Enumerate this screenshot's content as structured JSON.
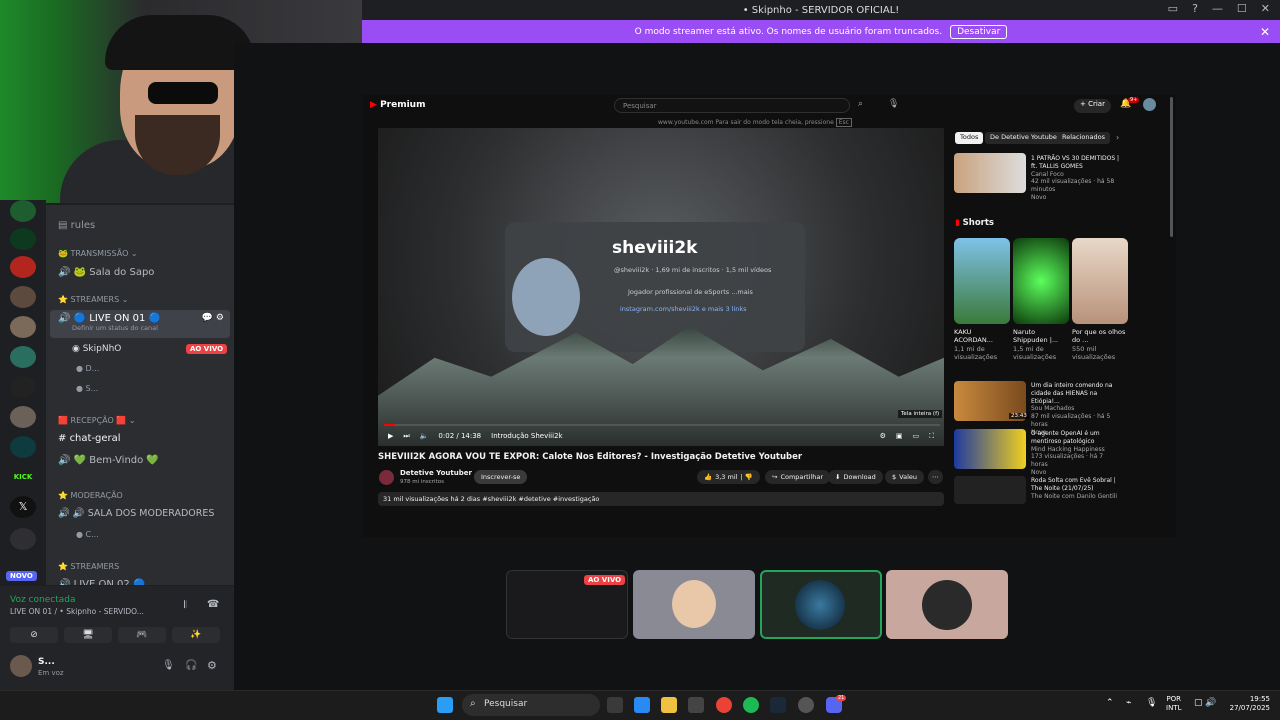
{
  "window": {
    "title": "• Skipnho - SERVIDOR OFICIAL!"
  },
  "banner": {
    "text": "O modo streamer está ativo. Os nomes de usuário foram truncados.",
    "button": "Desativar"
  },
  "channels": {
    "rules": "rules",
    "cat_transmissao": "TRANSMISSÃO",
    "sala_sapo": "Sala do Sapo",
    "cat_streamers": "STREAMERS",
    "live_on_01": "LIVE ON 01",
    "status_hint": "Definir um status do canal",
    "user1": "SkipNhO",
    "user1_badge": "AO VIVO",
    "user2": "D...",
    "user3": "S...",
    "cat_recepcao": "Recepção",
    "chat_geral": "chat-geral",
    "bem_vindo": "Bem-Vindo",
    "cat_moderacao": "MODERAÇÃO",
    "sala_mod": "SALA DOS MODERADORES",
    "user4": "C...",
    "cat_streamers2": "STREAMERS",
    "live_on_02": "LIVE ON 02",
    "novo_badge": "NOVO"
  },
  "voice": {
    "status": "Voz conectada",
    "channel": "LIVE ON 01 / • Skipnho - SERVIDO...",
    "user": "S...",
    "user_status": "Em voz"
  },
  "youtube": {
    "logo": "Premium",
    "search_placeholder": "Pesquisar",
    "create": "Criar",
    "notif_count": "9+",
    "url_hint": "www.youtube.com   Para sair do modo tela cheia, pressione",
    "url_key": "Esc",
    "video_title": "SHEVIII2K AGORA VOU TE EXPOR: Calote Nos Editores? - Investigação Detetive Youtuber",
    "channel_name": "Detetive Youtuber",
    "subs": "978 mi inscritos",
    "subscribe": "Inscrever-se",
    "likes": "3,3 mil",
    "share": "Compartilhar",
    "download": "Download",
    "thanks": "Valeu",
    "time": "0:02 / 14:38",
    "chapter": "Introdução Sheviii2k",
    "views_line": "31 mil visualizações  há 2 dias  #sheviii2k #detetive #investigação",
    "fullscreen_tip": "Tela inteira (f)",
    "card_name": "sheviii2k",
    "card_line1": "@sheviii2k · 1,69 mi de inscritos · 1,5 mil vídeos",
    "card_line2": "Jogador profissional de eSports ...mais",
    "card_link": "instagram.com/sheviii2k e mais 3 links",
    "chips": [
      "Todos",
      "De Detetive Youtuber",
      "Relacionados"
    ],
    "rec1_title": "1 PATRÃO VS 30 DEMITIDOS | ft. TALLIS GOMES",
    "rec1_channel": "Canal Foco",
    "rec1_meta": "42 mil visualizações · há 58 minutos",
    "rec1_badge": "Novo",
    "shorts_label": "Shorts",
    "shorts": [
      {
        "title": "KAKU ACORDAN...",
        "views": "1,1 mi de visualizações"
      },
      {
        "title": "Naruto Shippuden |...",
        "views": "1,5 mi de visualizações"
      },
      {
        "title": "Por que os olhos do ...",
        "views": "550 mil visualizações"
      }
    ],
    "rec2_title": "Um dia inteiro comendo na cidade das HIENAS na Etiópia!...",
    "rec2_channel": "Sou Machados",
    "rec2_meta": "87 mil visualizações · há 5 horas",
    "rec2_badge": "Novo",
    "rec2_dur": "23:43",
    "rec3_title": "O agente OpenAI é um mentiroso patológico",
    "rec3_channel": "Mind Hacking Happiness",
    "rec3_meta": "173 visualizações · há 7 horas",
    "rec3_badge": "Novo",
    "rec4_title": "Roda Solta com Evê Sobral | The Noite (21/07/25)",
    "rec4_channel": "The Noite com Danilo Gentili"
  },
  "tiles": {
    "live_badge": "AO VIVO"
  },
  "taskbar": {
    "search": "Pesquisar",
    "lang1": "POR",
    "lang2": "INTL",
    "time": "19:55",
    "date": "27/07/2025",
    "discord_badge": "21"
  }
}
